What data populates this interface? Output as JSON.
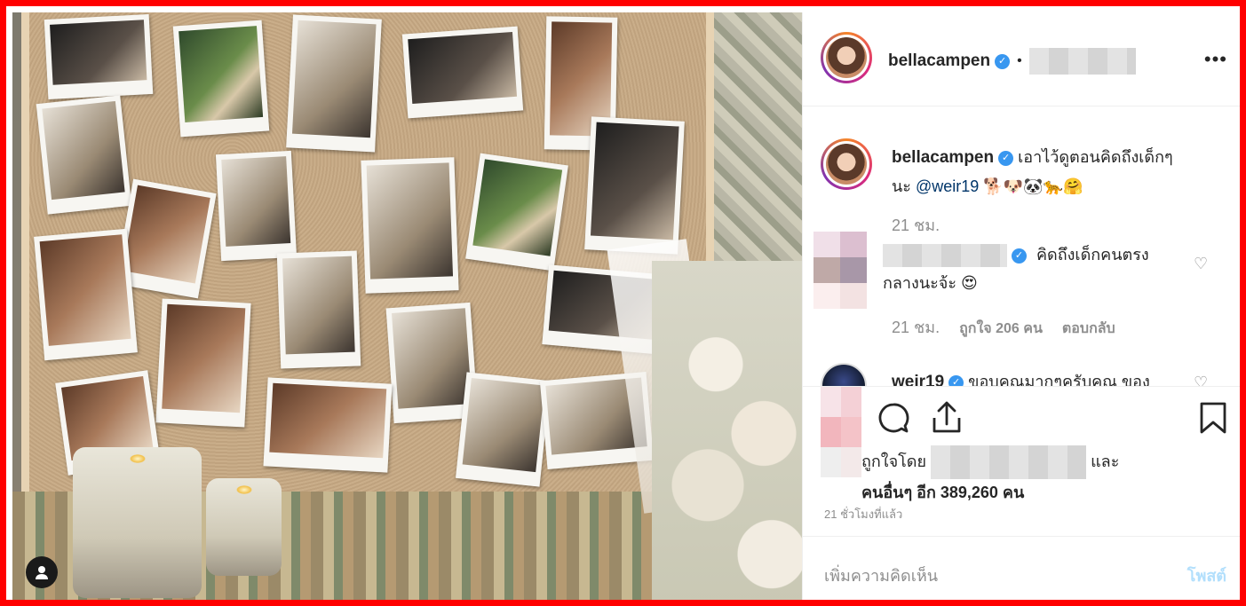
{
  "post": {
    "author": "bellacampen",
    "dot": "•",
    "more_icon": "more-horizontal-icon"
  },
  "caption": {
    "author": "bellacampen",
    "text_before": "เอาไว้ดูตอนคิดถึงเด็กๆ",
    "text_na": "นะ",
    "mention": "@weir19",
    "emojis": "🐕🐶🐼🐆🤗",
    "time": "21 ชม."
  },
  "comments": [
    {
      "text_line1": "คิดถึงเด็กคนตรง",
      "text_line2": "กลางนะจ้ะ",
      "emoji": "😍",
      "time": "21 ชม.",
      "likes": "ถูกใจ 206 คน",
      "reply": "ตอบกลับ"
    },
    {
      "author": "weir19",
      "text": "ขอบคุณมากๆครับคุณ ของ"
    }
  ],
  "likes": {
    "prefix": "ถูกใจโดย",
    "and": "และ",
    "others": "คนอื่นๆ อีก 389,260 คน"
  },
  "timestamp": "21 ชั่วโมงที่แล้ว",
  "comment_input": {
    "placeholder": "เพิ่มความคิดเห็น",
    "post_label": "โพสต์"
  },
  "colors": {
    "verified": "#3897f0",
    "border": "#ff0000",
    "post_disabled": "#b2dffc"
  }
}
